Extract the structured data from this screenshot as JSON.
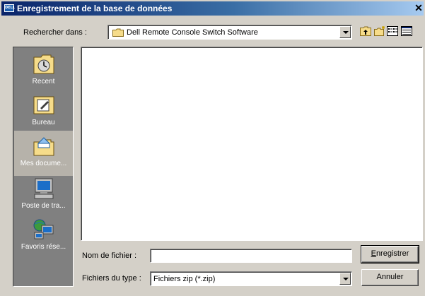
{
  "window": {
    "title": "Enregistrement de la base de données",
    "badge": "DELL",
    "close_glyph": "✕"
  },
  "lookin": {
    "label": "Rechercher dans :",
    "value": "Dell Remote Console Switch Software"
  },
  "toolbar": {
    "icons": [
      "up-folder-icon",
      "new-folder-icon",
      "list-view-icon",
      "details-view-icon"
    ]
  },
  "places": [
    {
      "label": "Recent",
      "icon": "recent-icon",
      "selected": false
    },
    {
      "label": "Bureau",
      "icon": "desktop-icon",
      "selected": false
    },
    {
      "label": "Mes docume...",
      "icon": "my-documents-icon",
      "selected": true
    },
    {
      "label": "Poste de tra...",
      "icon": "my-computer-icon",
      "selected": false
    },
    {
      "label": "Favoris rése...",
      "icon": "network-places-icon",
      "selected": false
    }
  ],
  "filename": {
    "label": "Nom de fichier :",
    "value": ""
  },
  "filetype": {
    "label": "Fichiers du type :",
    "value": "Fichiers zip (*.zip)"
  },
  "buttons": {
    "save_first": "E",
    "save_rest": "nregistrer",
    "cancel": "Annuler"
  }
}
